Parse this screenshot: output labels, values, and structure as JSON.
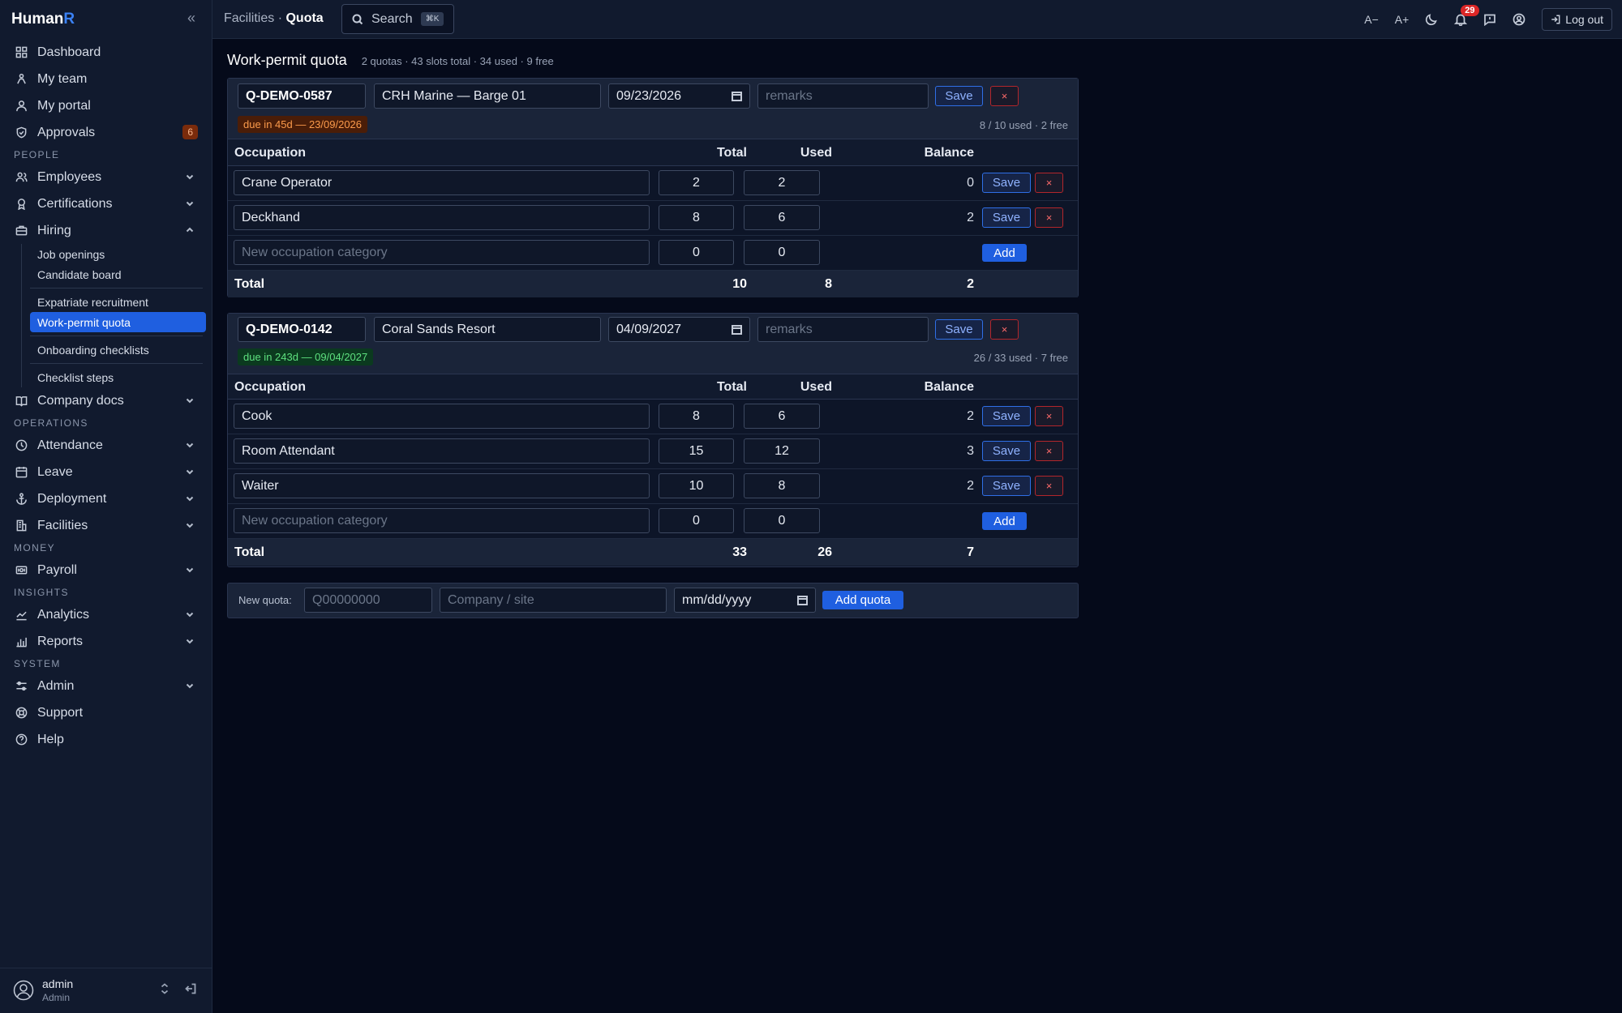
{
  "app": {
    "brand_main": "Human",
    "brand_accent": "R"
  },
  "topbar": {
    "crumb_parent": "Facilities",
    "crumb_sep": "·",
    "crumb_current": "Quota",
    "search_label": "Search",
    "search_kbd": "⌘K",
    "font_smaller": "A−",
    "font_larger": "A+",
    "notif_count": "29",
    "logout_label": "Log out"
  },
  "sidebar": {
    "items_top": [
      {
        "label": "Dashboard"
      },
      {
        "label": "My team"
      },
      {
        "label": "My portal"
      },
      {
        "label": "Approvals",
        "badge": "6"
      }
    ],
    "section_people": "PEOPLE",
    "people": [
      {
        "label": "Employees"
      },
      {
        "label": "Certifications"
      },
      {
        "label": "Hiring"
      }
    ],
    "hiring_sub": [
      "Job openings",
      "Candidate board",
      "Expatriate recruitment",
      "Work-permit quota",
      "Onboarding checklists",
      "Checklist steps"
    ],
    "company_docs": "Company docs",
    "section_operations": "OPERATIONS",
    "operations": [
      {
        "label": "Attendance"
      },
      {
        "label": "Leave"
      },
      {
        "label": "Deployment"
      },
      {
        "label": "Facilities"
      }
    ],
    "section_money": "MONEY",
    "money": [
      {
        "label": "Payroll"
      }
    ],
    "section_insights": "INSIGHTS",
    "insights": [
      {
        "label": "Analytics"
      },
      {
        "label": "Reports"
      }
    ],
    "section_system": "SYSTEM",
    "system": [
      {
        "label": "Admin"
      },
      {
        "label": "Support"
      },
      {
        "label": "Help"
      }
    ],
    "user_name": "admin",
    "user_role": "Admin"
  },
  "page": {
    "title": "Work-permit quota",
    "summary": "2 quotas · 43 slots total · 34 used · 9 free"
  },
  "labels": {
    "save": "Save",
    "delete": "×",
    "add": "Add",
    "occupation": "Occupation",
    "total": "Total",
    "used": "Used",
    "balance": "Balance",
    "new_occupation_placeholder": "New occupation category",
    "zero": "0",
    "remarks_placeholder": "remarks"
  },
  "quotas": [
    {
      "code": "Q-DEMO-0587",
      "company": "CRH Marine — Barge 01",
      "date": "09/23/2026",
      "due": "due in 45d — 23/09/2026",
      "usage": "8 / 10 used · 2 free",
      "rows": [
        {
          "occupation": "Crane Operator",
          "total": "2",
          "used": "2",
          "balance": "0"
        },
        {
          "occupation": "Deckhand",
          "total": "8",
          "used": "6",
          "balance": "2"
        }
      ],
      "footer": {
        "label": "Total",
        "total": "10",
        "used": "8",
        "balance": "2"
      }
    },
    {
      "code": "Q-DEMO-0142",
      "company": "Coral Sands Resort",
      "date": "04/09/2027",
      "due": "due in 243d — 09/04/2027",
      "usage": "26 / 33 used · 7 free",
      "rows": [
        {
          "occupation": "Cook",
          "total": "8",
          "used": "6",
          "balance": "2"
        },
        {
          "occupation": "Room Attendant",
          "total": "15",
          "used": "12",
          "balance": "3"
        },
        {
          "occupation": "Waiter",
          "total": "10",
          "used": "8",
          "balance": "2"
        }
      ],
      "footer": {
        "label": "Total",
        "total": "33",
        "used": "26",
        "balance": "7"
      }
    }
  ],
  "new_quota": {
    "label": "New quota:",
    "code_placeholder": "Q00000000",
    "company_placeholder": "Company / site",
    "date_placeholder": "mm/dd/yyyy",
    "button": "Add quota"
  },
  "colors": {
    "background": "#050a1a",
    "sidebar": "#111a2e",
    "accent": "#1f5fe0",
    "danger": "#b3262b",
    "warn": "#fb9a4b",
    "ok": "#5ee07f"
  }
}
